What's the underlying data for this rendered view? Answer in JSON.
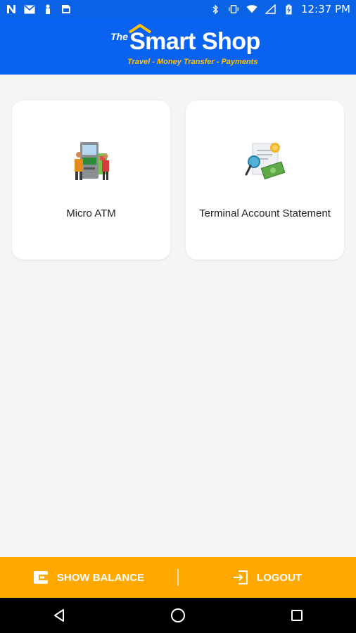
{
  "status_bar": {
    "time": "12:37 PM",
    "left_icons": [
      "n-icon",
      "mail-icon",
      "person-icon",
      "sim-icon"
    ],
    "right_icons": [
      "bluetooth-icon",
      "vibrate-icon",
      "wifi-icon",
      "signal-icon",
      "battery-icon"
    ]
  },
  "header": {
    "logo_prefix": "The",
    "logo_name": "Smart Shop",
    "tagline": "Travel - Money Transfer - Payments",
    "background": "#0a63f0",
    "tagline_color": "#ffc107"
  },
  "cards": [
    {
      "label": "Micro ATM",
      "icon": "micro-atm-icon"
    },
    {
      "label": "Terminal Account Statement",
      "icon": "account-statement-icon"
    }
  ],
  "action_bar": {
    "background": "#ffa800",
    "show_balance_label": "SHOW BALANCE",
    "show_balance_icon": "wallet-icon",
    "logout_label": "LOGOUT",
    "logout_icon": "logout-icon"
  },
  "nav_bar": {
    "buttons": [
      "back-icon",
      "home-icon",
      "recents-icon"
    ]
  }
}
